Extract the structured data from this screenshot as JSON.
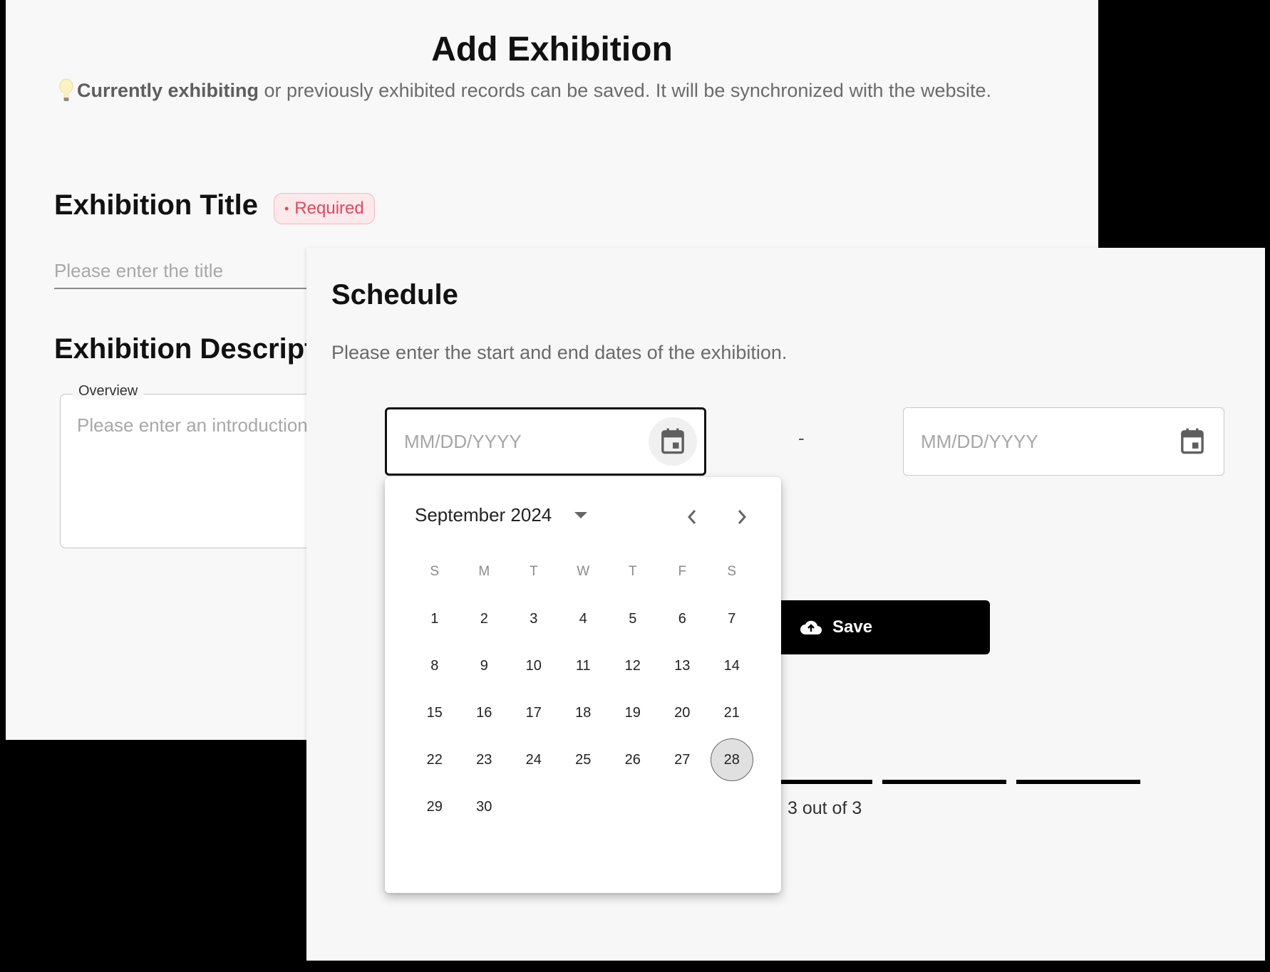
{
  "back_form": {
    "title": "Add Exhibition",
    "notice": {
      "icon": "lightbulb-icon",
      "bold": "Currently exhibiting",
      "rest": " or previously exhibited records can be saved. It will be synchronized with the website."
    },
    "exhibition_title": {
      "label": "Exhibition Title",
      "badge": "Required",
      "placeholder": "Please enter the title",
      "value": ""
    },
    "exhibition_description": {
      "label": "Exhibition Description",
      "legend": "Overview",
      "placeholder": "Please enter an introduction",
      "value": ""
    }
  },
  "schedule": {
    "title": "Schedule",
    "description": "Please enter the start and end dates of the exhibition.",
    "start_date": {
      "placeholder": "MM/DD/YYYY",
      "value": "",
      "icon": "calendar-icon",
      "focused": true
    },
    "separator": "-",
    "end_date": {
      "placeholder": "MM/DD/YYYY",
      "value": "",
      "icon": "calendar-icon"
    },
    "save_button": {
      "label": "Save",
      "icon": "cloud-upload-icon"
    },
    "progress": {
      "current": 3,
      "total": 3,
      "label": "3 out of 3"
    }
  },
  "calendar": {
    "month_label": "September 2024",
    "weekdays": [
      "S",
      "M",
      "T",
      "W",
      "T",
      "F",
      "S"
    ],
    "first_weekday_index": 0,
    "days_in_month": 30,
    "today": 28,
    "icons": {
      "dropdown": "caret-down-icon",
      "prev": "chevron-left-icon",
      "next": "chevron-right-icon"
    }
  }
}
